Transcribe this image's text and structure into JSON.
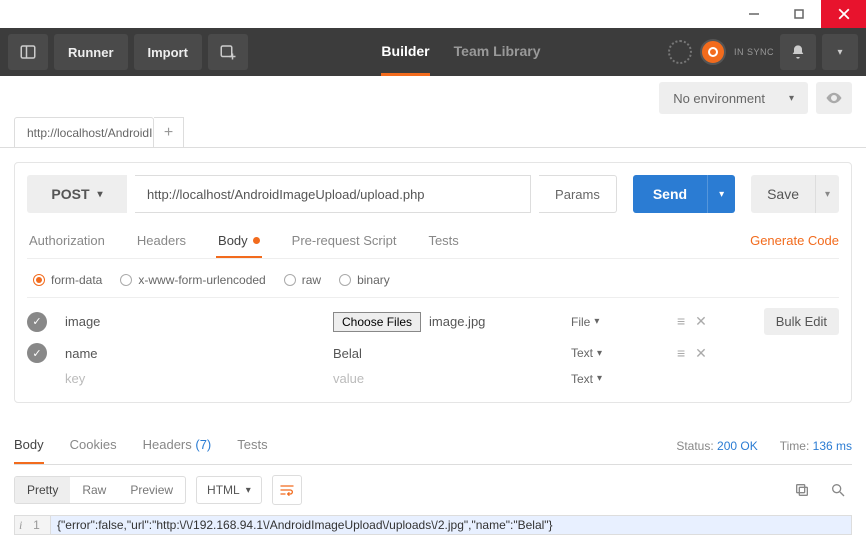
{
  "toolbar": {
    "runner": "Runner",
    "import": "Import",
    "builder": "Builder",
    "team_library": "Team Library",
    "sync_text": "IN SYNC"
  },
  "env": {
    "label": "No environment"
  },
  "tabs": {
    "active": "http://localhost/AndroidIm"
  },
  "request": {
    "method": "POST",
    "url": "http://localhost/AndroidImageUpload/upload.php",
    "params_label": "Params",
    "send_label": "Send",
    "save_label": "Save"
  },
  "sub_tabs": {
    "auth": "Authorization",
    "headers": "Headers",
    "body": "Body",
    "pre": "Pre-request Script",
    "tests": "Tests",
    "generate": "Generate Code"
  },
  "body_type": {
    "form_data": "form-data",
    "urlencoded": "x-www-form-urlencoded",
    "raw": "raw",
    "binary": "binary"
  },
  "form_data": {
    "choose_files": "Choose Files",
    "bulk_edit": "Bulk Edit",
    "key_placeholder": "key",
    "value_placeholder": "value",
    "rows": [
      {
        "key": "image",
        "value_file": "image.jpg",
        "type": "File"
      },
      {
        "key": "name",
        "value": "Belal",
        "type": "Text"
      }
    ],
    "last_type": "Text"
  },
  "response_tabs": {
    "body": "Body",
    "cookies": "Cookies",
    "headers": "Headers",
    "headers_count": "(7)",
    "tests": "Tests"
  },
  "response_status": {
    "status_label": "Status:",
    "status_value": "200 OK",
    "time_label": "Time:",
    "time_value": "136 ms"
  },
  "view_modes": {
    "pretty": "Pretty",
    "raw": "Raw",
    "preview": "Preview",
    "lang": "HTML"
  },
  "response_body": {
    "line_number": "1",
    "content": "{\"error\":false,\"url\":\"http:\\/\\/192.168.94.1\\/AndroidImageUpload\\/uploads\\/2.jpg\",\"name\":\"Belal\"}"
  }
}
